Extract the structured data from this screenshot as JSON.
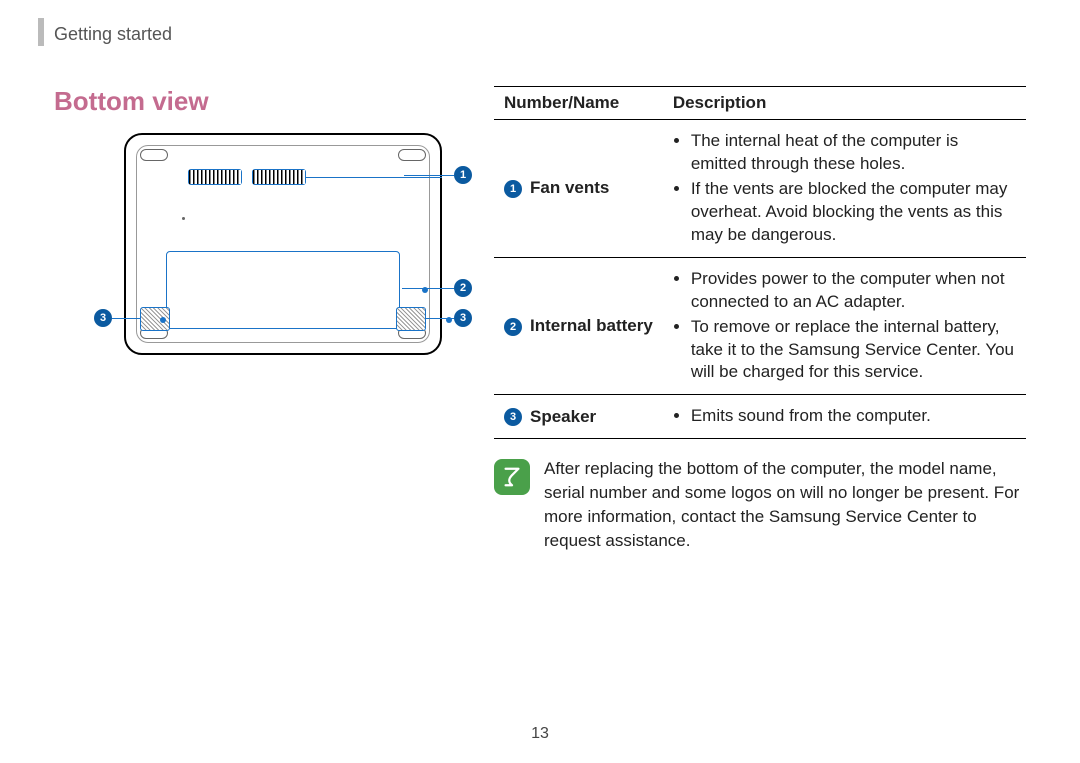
{
  "breadcrumb": "Getting started",
  "section_title": "Bottom view",
  "callouts": {
    "c1": "1",
    "c2": "2",
    "c3": "3"
  },
  "table": {
    "header": {
      "col1": "Number/Name",
      "col2": "Description"
    },
    "rows": [
      {
        "num": "1",
        "name": "Fan vents",
        "bullets": [
          "The internal heat of the computer is emitted through these holes.",
          "If the vents are blocked the computer may overheat. Avoid blocking the vents as this may be dangerous."
        ]
      },
      {
        "num": "2",
        "name": "Internal battery",
        "bullets": [
          "Provides power to the computer when not connected to an AC adapter.",
          "To remove or replace the internal battery, take it to the Samsung Service Center. You will be charged for this service."
        ]
      },
      {
        "num": "3",
        "name": "Speaker",
        "bullets": [
          "Emits sound from the computer."
        ]
      }
    ]
  },
  "note": "After replacing the bottom of the computer, the model name, serial number and some logos on will no longer be present. For more information, contact the Samsung Service Center to request assistance.",
  "page_number": "13"
}
